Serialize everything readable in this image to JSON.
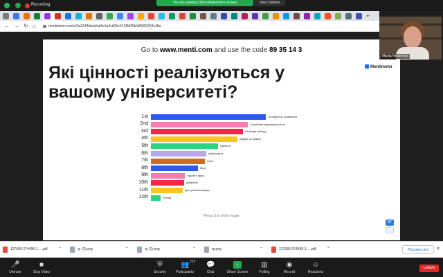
{
  "zoom_top": {
    "recording_label": "Recording",
    "viewing_banner": "You are viewing Olena Malashek's screen",
    "view_options_label": "View Options"
  },
  "browser": {
    "url": "mentimeter.com/s/3a2344fdea2ab6c1a6cb29e4218fd26b/d65820f04c48a",
    "new_tab": "+"
  },
  "slide": {
    "goto_prefix": "Go to ",
    "goto_site": "www.menti.com",
    "goto_middle": " and use the code ",
    "goto_code": "89 35 14 3",
    "brand": "Mentimeter",
    "question": "Які цінності реалізуються у вашому університеті?",
    "hint": "Press S to show image",
    "badge_count": "87"
  },
  "chart_data": {
    "type": "bar",
    "orientation": "horizontal",
    "categories": [
      "1st",
      "2nd",
      "3rd",
      "4th",
      "5th",
      "6th",
      "7th",
      "8th",
      "9th",
      "10th",
      "11th",
      "12th"
    ],
    "labels": [
      "Толерантне ставлення",
      "Соціальна відповідальність",
      "Свобода вибору",
      "Довіра та повага",
      "Рівність",
      "Демократія",
      "Сім'я",
      "Мир",
      "Гарантії прав",
      "Дозвілля",
      "Доступний комфорт",
      "Релігія"
    ],
    "values": [
      166,
      140,
      133,
      125,
      97,
      80,
      78,
      68,
      49,
      48,
      46,
      14
    ],
    "colors": [
      "#2e5be6",
      "#f27fae",
      "#f2254b",
      "#f7c623",
      "#2fd47f",
      "#b8a7ea",
      "#d06d1f",
      "#2e5be6",
      "#f27fae",
      "#f2254b",
      "#f7c623",
      "#2fd47f"
    ]
  },
  "video": {
    "participant_name": "Marija Nesterova"
  },
  "downloads": {
    "items": [
      {
        "name": "127689-274498-1-....pdf",
        "type": "pdf"
      },
      {
        "name": "qr (2).png",
        "type": "png"
      },
      {
        "name": "qr (1).png",
        "type": "png"
      },
      {
        "name": "qr.png",
        "type": "png"
      },
      {
        "name": "127689-274498-1-....pdf",
        "type": "pdf"
      }
    ],
    "show_all_label": "Показать все",
    "close_glyph": "✕"
  },
  "toolbar": {
    "unmute": "Unmute",
    "stop_video": "Stop Video",
    "security": "Security",
    "participants": "Participants",
    "participants_count": "213",
    "chat": "Chat",
    "share_screen": "Share Screen",
    "polling": "Polling",
    "record": "Record",
    "reactions": "Reactions",
    "leave": "Leave"
  }
}
